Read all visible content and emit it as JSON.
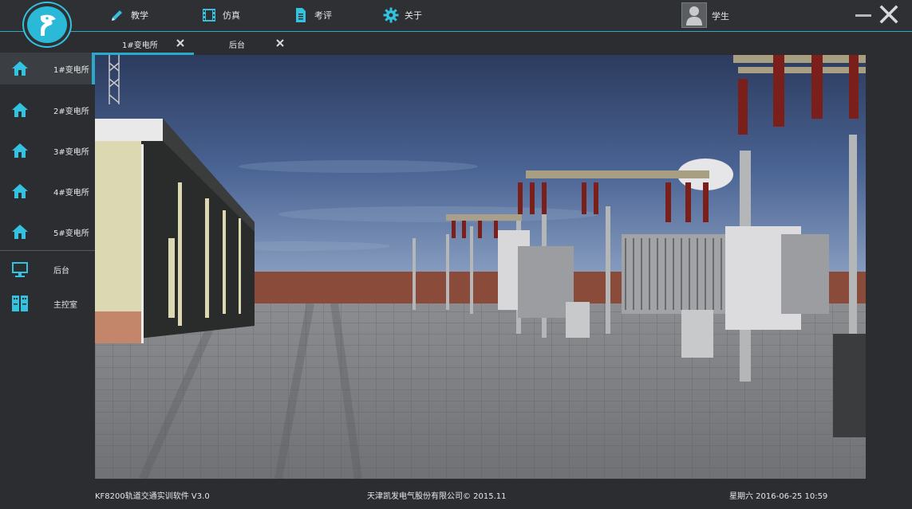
{
  "topnav": {
    "items": [
      {
        "label": "教学",
        "icon": "pencil-icon"
      },
      {
        "label": "仿真",
        "icon": "film-icon"
      },
      {
        "label": "考评",
        "icon": "document-icon"
      },
      {
        "label": "关于",
        "icon": "gear-icon"
      }
    ],
    "user_label": "学生"
  },
  "tabs": [
    {
      "label": "1#变电所",
      "active": true
    },
    {
      "label": "后台",
      "active": false
    }
  ],
  "sidebar": {
    "items": [
      {
        "label": "1#变电所",
        "icon": "home-icon"
      },
      {
        "label": "2#变电所",
        "icon": "home-icon"
      },
      {
        "label": "3#变电所",
        "icon": "home-icon"
      },
      {
        "label": "4#变电所",
        "icon": "home-icon"
      },
      {
        "label": "5#变电所",
        "icon": "home-icon"
      },
      {
        "label": "后台",
        "icon": "monitor-icon"
      },
      {
        "label": "主控室",
        "icon": "control-panel-icon"
      }
    ]
  },
  "footer": {
    "left": "KF8200轨道交通实训软件 V3.0",
    "center": "天津凯发电气股份有限公司© 2015.11",
    "right": "星期六 2016-06-25 10:59"
  },
  "colors": {
    "accent": "#2aa9c9",
    "background": "#2b2d30"
  }
}
